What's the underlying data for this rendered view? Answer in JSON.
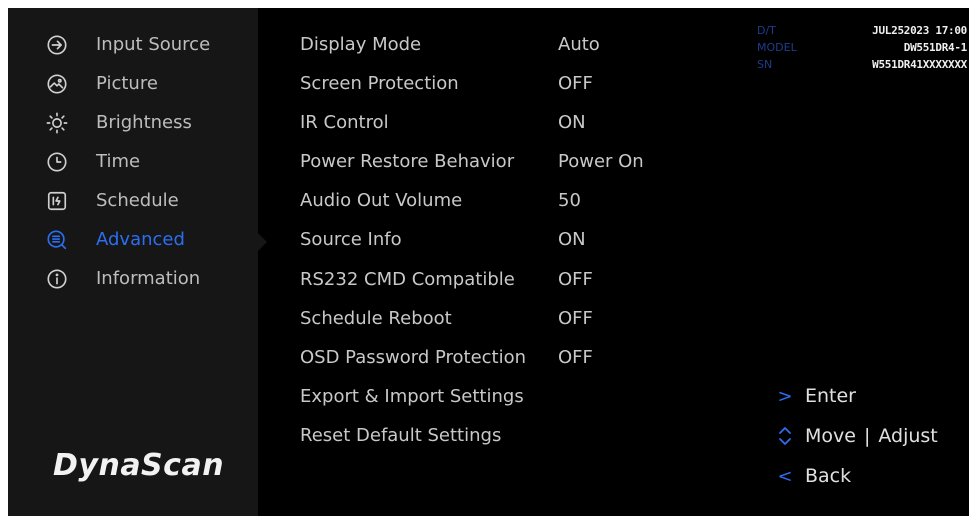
{
  "sidebar": {
    "items": [
      {
        "label": "Input Source",
        "icon": "input-source-icon"
      },
      {
        "label": "Picture",
        "icon": "picture-icon"
      },
      {
        "label": "Brightness",
        "icon": "brightness-icon"
      },
      {
        "label": "Time",
        "icon": "clock-icon"
      },
      {
        "label": "Schedule",
        "icon": "schedule-icon"
      },
      {
        "label": "Advanced",
        "icon": "advanced-icon",
        "active": true
      },
      {
        "label": "Information",
        "icon": "info-icon"
      }
    ],
    "brand": "DynaScan"
  },
  "menu": {
    "rows": [
      {
        "label": "Display Mode",
        "value": "Auto"
      },
      {
        "label": "Screen Protection",
        "value": "OFF"
      },
      {
        "label": "IR Control",
        "value": "ON"
      },
      {
        "label": "Power Restore Behavior",
        "value": "Power On"
      },
      {
        "label": "Audio Out Volume",
        "value": "50"
      },
      {
        "label": "Source Info",
        "value": "ON"
      },
      {
        "label": "RS232 CMD Compatible",
        "value": "OFF"
      },
      {
        "label": "Schedule Reboot",
        "value": "OFF"
      },
      {
        "label": "OSD Password Protection",
        "value": "OFF"
      },
      {
        "label": "Export & Import Settings",
        "value": ""
      },
      {
        "label": "Reset Default Settings",
        "value": ""
      }
    ]
  },
  "info": {
    "dt_label": "D/T",
    "dt_value": "JUL252023 17:00",
    "model_label": "MODEL",
    "model_value": "DW551DR4-1",
    "sn_label": "SN",
    "sn_value": "W551DR41XXXXXXX"
  },
  "hints": {
    "enter_icon": ">",
    "enter_label": "Enter",
    "move_label": "Move",
    "separator": "|",
    "adjust_label": "Adjust",
    "back_icon": "<",
    "back_label": "Back"
  },
  "colors": {
    "accent": "#2c6ef2",
    "sidebar_bg": "#161616",
    "screen_bg": "#000000",
    "label_key": "#1f3c8c"
  }
}
